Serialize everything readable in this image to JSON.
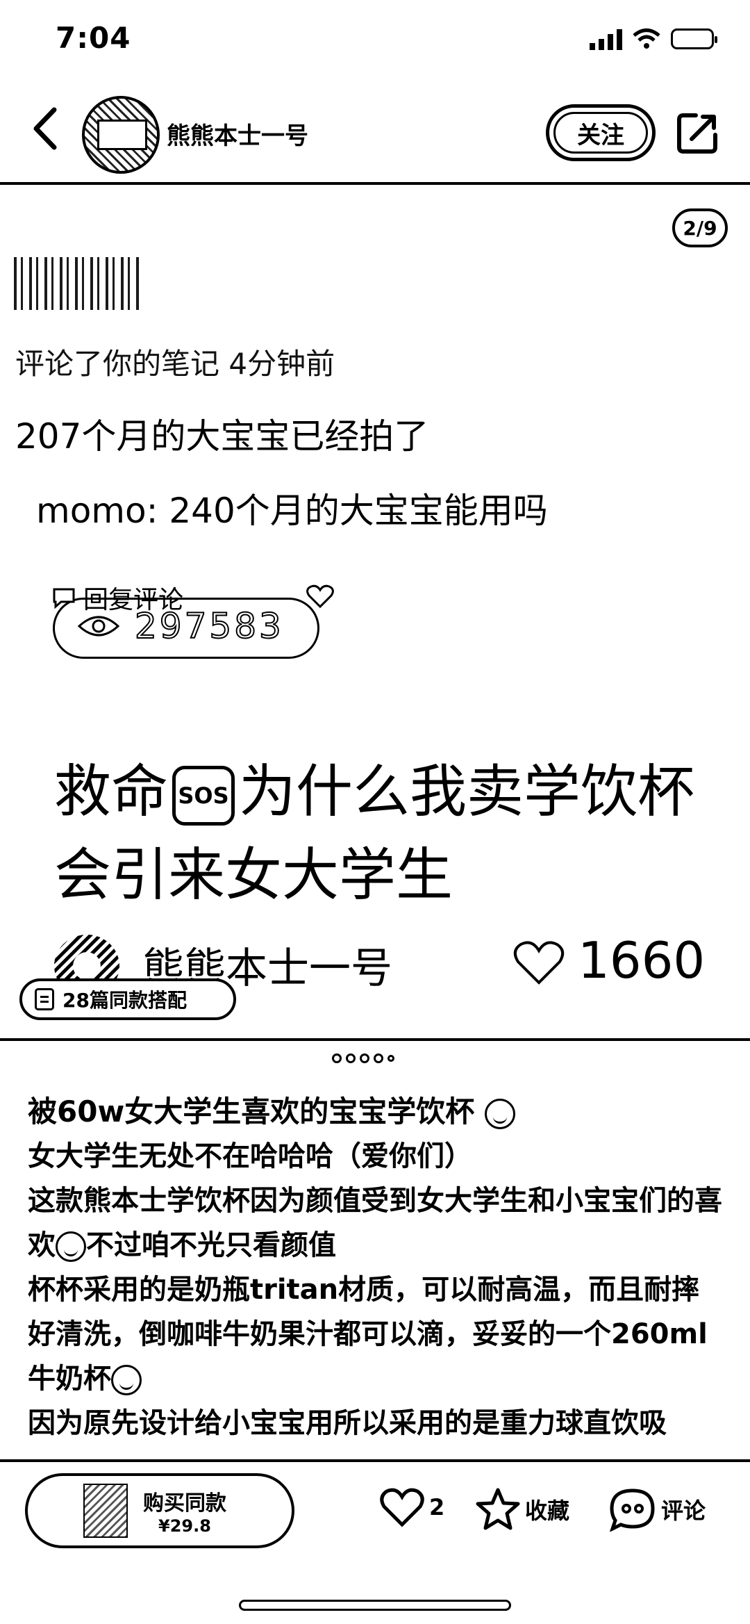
{
  "status_bar": {
    "time": "7:04"
  },
  "header": {
    "author_name": "熊熊本士一号",
    "follow_label": "关注"
  },
  "image": {
    "page_indicator": "2/9",
    "notification": {
      "commented_text": "评论了你的笔记  4分钟前",
      "comment": "207个月的大宝宝已经拍了",
      "quoted": "momo: 240个月的大宝宝能用吗",
      "reply_label": "回复评论",
      "view_count": "297583"
    },
    "title_part1": "救命",
    "sos": "SOS",
    "title_part2": "为什么我卖学饮杯会引来女大学生",
    "author_name": "熊熊本士一号",
    "likes": "1660",
    "collection_label": "28篇同款搭配"
  },
  "description": {
    "title": "被60w女大学生喜欢的宝宝学饮杯",
    "line1": "女大学生无处不在哈哈哈（爱你们）",
    "line2": "这款熊本士学饮杯因为颜值受到女大学生和小宝宝们的喜欢",
    "line2b": "不过咱不光只看颜值",
    "line3": "杯杯采用的是奶瓶tritan材质，可以耐高温，而且耐摔好清洗，倒咖啡牛奶果汁都可以滴，妥妥的一个260ml牛奶杯",
    "line4": "因为原先设计给小宝宝用所以采用的是重力球直饮吸"
  },
  "bottom_bar": {
    "buy_label": "购买同款",
    "buy_price": "¥29.8",
    "like_count": "2",
    "collect_label": "收藏",
    "comment_label": "评论"
  }
}
